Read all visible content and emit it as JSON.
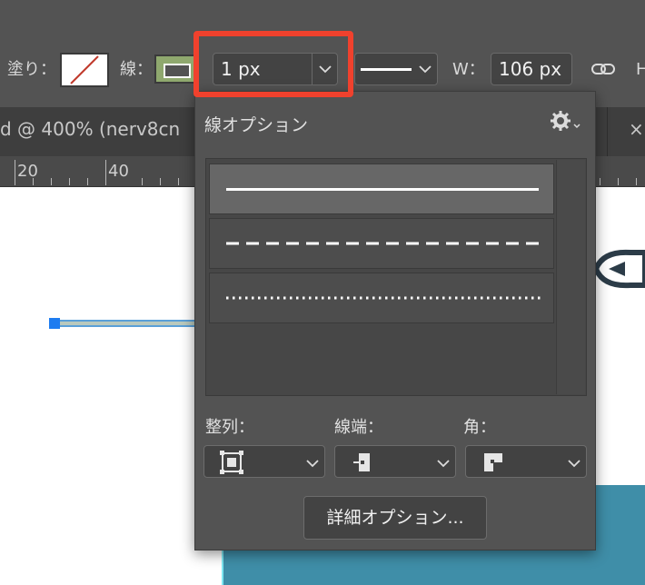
{
  "toolbar": {
    "fill_label": "塗り：",
    "stroke_label": "線：",
    "stroke_width_value": "1 px",
    "width_label": "W：",
    "width_value": "106 px"
  },
  "document_tab": {
    "title": "d @ 400% (nerv8cn",
    "suffix": ")"
  },
  "ruler": {
    "marks": [
      "20",
      "40"
    ]
  },
  "stroke_options": {
    "title": "線オプション",
    "styles": [
      "solid",
      "dashed",
      "dotted"
    ],
    "selected_style": "solid",
    "align_label": "整列：",
    "cap_label": "線端：",
    "corner_label": "角：",
    "more_options_button": "詳細オプション..."
  },
  "colors": {
    "highlight": "#f0412d",
    "selection_blue": "#1e7cf0",
    "stroke_swatch": "#8fa86e",
    "teal_shape": "#3f8ea8"
  }
}
